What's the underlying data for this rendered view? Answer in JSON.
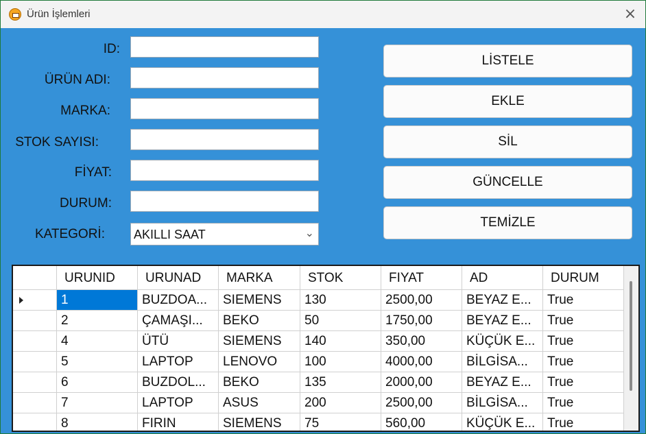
{
  "window": {
    "title": "Ürün İşlemleri",
    "close_icon": "×"
  },
  "form": {
    "labels": {
      "id": "ID:",
      "urun_adi": "ÜRÜN ADI:",
      "marka": "MARKA:",
      "stok": "STOK SAYISI:",
      "fiyat": "FİYAT:",
      "durum": "DURUM:",
      "kategori": "KATEGORİ:"
    },
    "values": {
      "id": "",
      "urun_adi": "",
      "marka": "",
      "stok": "",
      "fiyat": "",
      "durum": ""
    },
    "kategori_selected": "AKILLI SAAT",
    "dropdown_icon": "⌄"
  },
  "buttons": {
    "listele": "LİSTELE",
    "ekle": "EKLE",
    "sil": "SİL",
    "guncelle": "GÜNCELLE",
    "temizle": "TEMİZLE"
  },
  "grid": {
    "columns": [
      "URUNID",
      "URUNAD",
      "MARKA",
      "STOK",
      "FIYAT",
      "AD",
      "DURUM"
    ],
    "rows": [
      [
        "1",
        "BUZDOA...",
        "SIEMENS",
        "130",
        "2500,00",
        "BEYAZ E...",
        "True"
      ],
      [
        "2",
        "ÇAMAŞI...",
        "BEKO",
        "50",
        "1750,00",
        "BEYAZ E...",
        "True"
      ],
      [
        "4",
        "ÜTÜ",
        "SIEMENS",
        "140",
        "350,00",
        "KÜÇÜK E...",
        "True"
      ],
      [
        "5",
        "LAPTOP",
        "LENOVO",
        "100",
        "4000,00",
        "BİLGİSA...",
        "True"
      ],
      [
        "6",
        "BUZDOL...",
        "BEKO",
        "135",
        "2000,00",
        "BEYAZ E...",
        "True"
      ],
      [
        "7",
        "LAPTOP",
        "ASUS",
        "200",
        "2500,00",
        "BİLGİSA...",
        "True"
      ],
      [
        "8",
        "FIRIN",
        "SIEMENS",
        "75",
        "560,00",
        "KÜÇÜK E...",
        "True"
      ]
    ],
    "selected_row": 0
  },
  "colors": {
    "background": "#3591d8",
    "selection": "#0078d7"
  }
}
